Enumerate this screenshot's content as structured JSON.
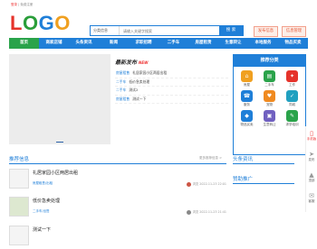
{
  "topbar": {
    "login": "登录",
    "register": "免费注册"
  },
  "logo": {
    "l1": "L",
    "l2": "O",
    "l3": "G",
    "l4": "O"
  },
  "search": {
    "category": "分类信息",
    "placeholder": "请输入关键字搜索",
    "button": "搜 索"
  },
  "header_buttons": {
    "post": "发布信息",
    "manage": "信息管理"
  },
  "nav": [
    "首页",
    "商家店铺",
    "头条资讯",
    "新闻",
    "求职招聘",
    "二手车",
    "房屋租赁",
    "生意转让",
    "本地服务",
    "物品买卖"
  ],
  "latest": {
    "title": "最新发布",
    "badge": "NEW",
    "rows": [
      {
        "cat": "房屋租售",
        "text": "礼居家园小区两居出租"
      },
      {
        "cat": "二手车",
        "text": "低价急卖处理"
      },
      {
        "cat": "二手车",
        "text": "测试2"
      },
      {
        "cat": "房屋租售",
        "text": "测试一下"
      }
    ]
  },
  "categories": {
    "title": "推荐分类",
    "items": [
      {
        "label": "房屋",
        "color": "#f0a020",
        "icon": "⌂"
      },
      {
        "label": "二手车",
        "color": "#2aa34a",
        "icon": "▤"
      },
      {
        "label": "工作",
        "color": "#e5332b",
        "icon": "✦"
      },
      {
        "label": "服务",
        "color": "#1f7fd8",
        "icon": "☎"
      },
      {
        "label": "宠物",
        "color": "#f08a20",
        "icon": "♥"
      },
      {
        "label": "同城",
        "color": "#20a0c0",
        "icon": "✓"
      },
      {
        "label": "物品买卖",
        "color": "#1f7fd8",
        "icon": "◆"
      },
      {
        "label": "生意转让",
        "color": "#7060c0",
        "icon": "▣"
      },
      {
        "label": "求学培训",
        "color": "#2aa34a",
        "icon": "✎"
      }
    ]
  },
  "side_tools": [
    "手机版",
    "发布",
    "顶部",
    "客服"
  ],
  "recommend": {
    "title": "推荐信息",
    "more": "更多推荐信息 >",
    "items": [
      {
        "title": "礼居家园小区两居出租",
        "cat": "房屋租售/出租",
        "meta": "浏览 2022-11-23 22:01"
      },
      {
        "title": "低价急卖处理",
        "cat": "二手车/出售",
        "meta": "浏览 2022-11-23 21:41"
      },
      {
        "title": "测试一下",
        "cat": "",
        "meta": ""
      }
    ]
  },
  "right": {
    "news": "头条资讯",
    "promo": "赞助推广"
  }
}
